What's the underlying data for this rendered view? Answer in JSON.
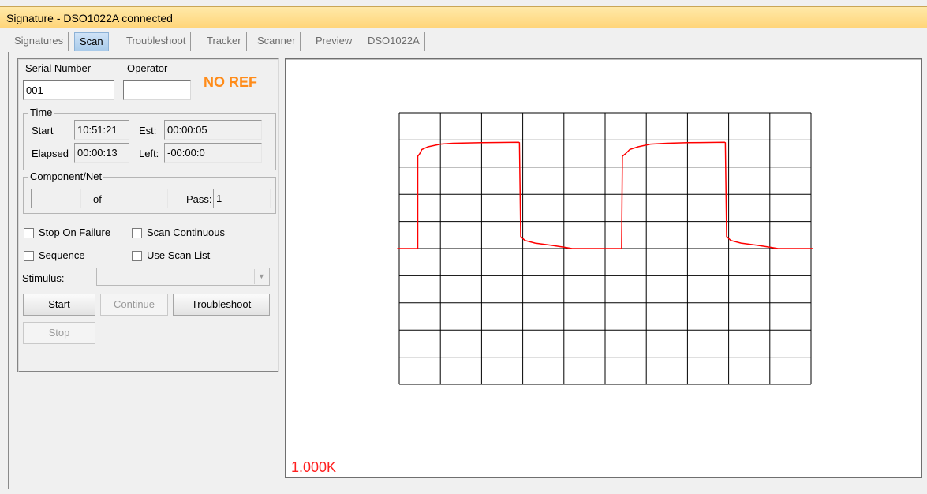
{
  "window": {
    "title": "Signature - DSO1022A connected"
  },
  "tabs": [
    {
      "label": "Signatures",
      "active": false
    },
    {
      "label": "Scan",
      "active": true
    },
    {
      "label": "Troubleshoot",
      "active": false
    },
    {
      "label": "Tracker",
      "active": false
    },
    {
      "label": "Scanner",
      "active": false
    },
    {
      "label": "Preview",
      "active": false
    },
    {
      "label": "DSO1022A",
      "active": false
    }
  ],
  "form": {
    "serial_number_label": "Serial Number",
    "serial_number_value": "001",
    "operator_label": "Operator",
    "operator_value": "",
    "no_ref": "NO REF",
    "time": {
      "legend": "Time",
      "start_label": "Start",
      "start_value": "10:51:21",
      "est_label": "Est:",
      "est_value": "00:00:05",
      "elapsed_label": "Elapsed",
      "elapsed_value": "00:00:13",
      "left_label": "Left:",
      "left_value": "-00:00:0"
    },
    "component": {
      "legend": "Component/Net",
      "current_value": "",
      "of_label": "of",
      "total_value": "",
      "pass_label": "Pass:",
      "pass_value": "1"
    },
    "options": {
      "stop_on_failure": "Stop On Failure",
      "scan_continuous": "Scan Continuous",
      "sequence": "Sequence",
      "use_scan_list": "Use Scan List"
    },
    "stimulus_label": "Stimulus:",
    "stimulus_value": "",
    "buttons": {
      "start": "Start",
      "continue": "Continue",
      "troubleshoot": "Troubleshoot",
      "stop": "Stop"
    }
  },
  "scope": {
    "label": "1.000K",
    "trace_color": "#ff0000",
    "grid_color": "#000000",
    "grid_columns": 10,
    "grid_rows": 10
  },
  "colors": {
    "accent_orange": "#ff8c1a",
    "title_bar": "#ffd57a",
    "active_tab": "#a9cbea"
  }
}
